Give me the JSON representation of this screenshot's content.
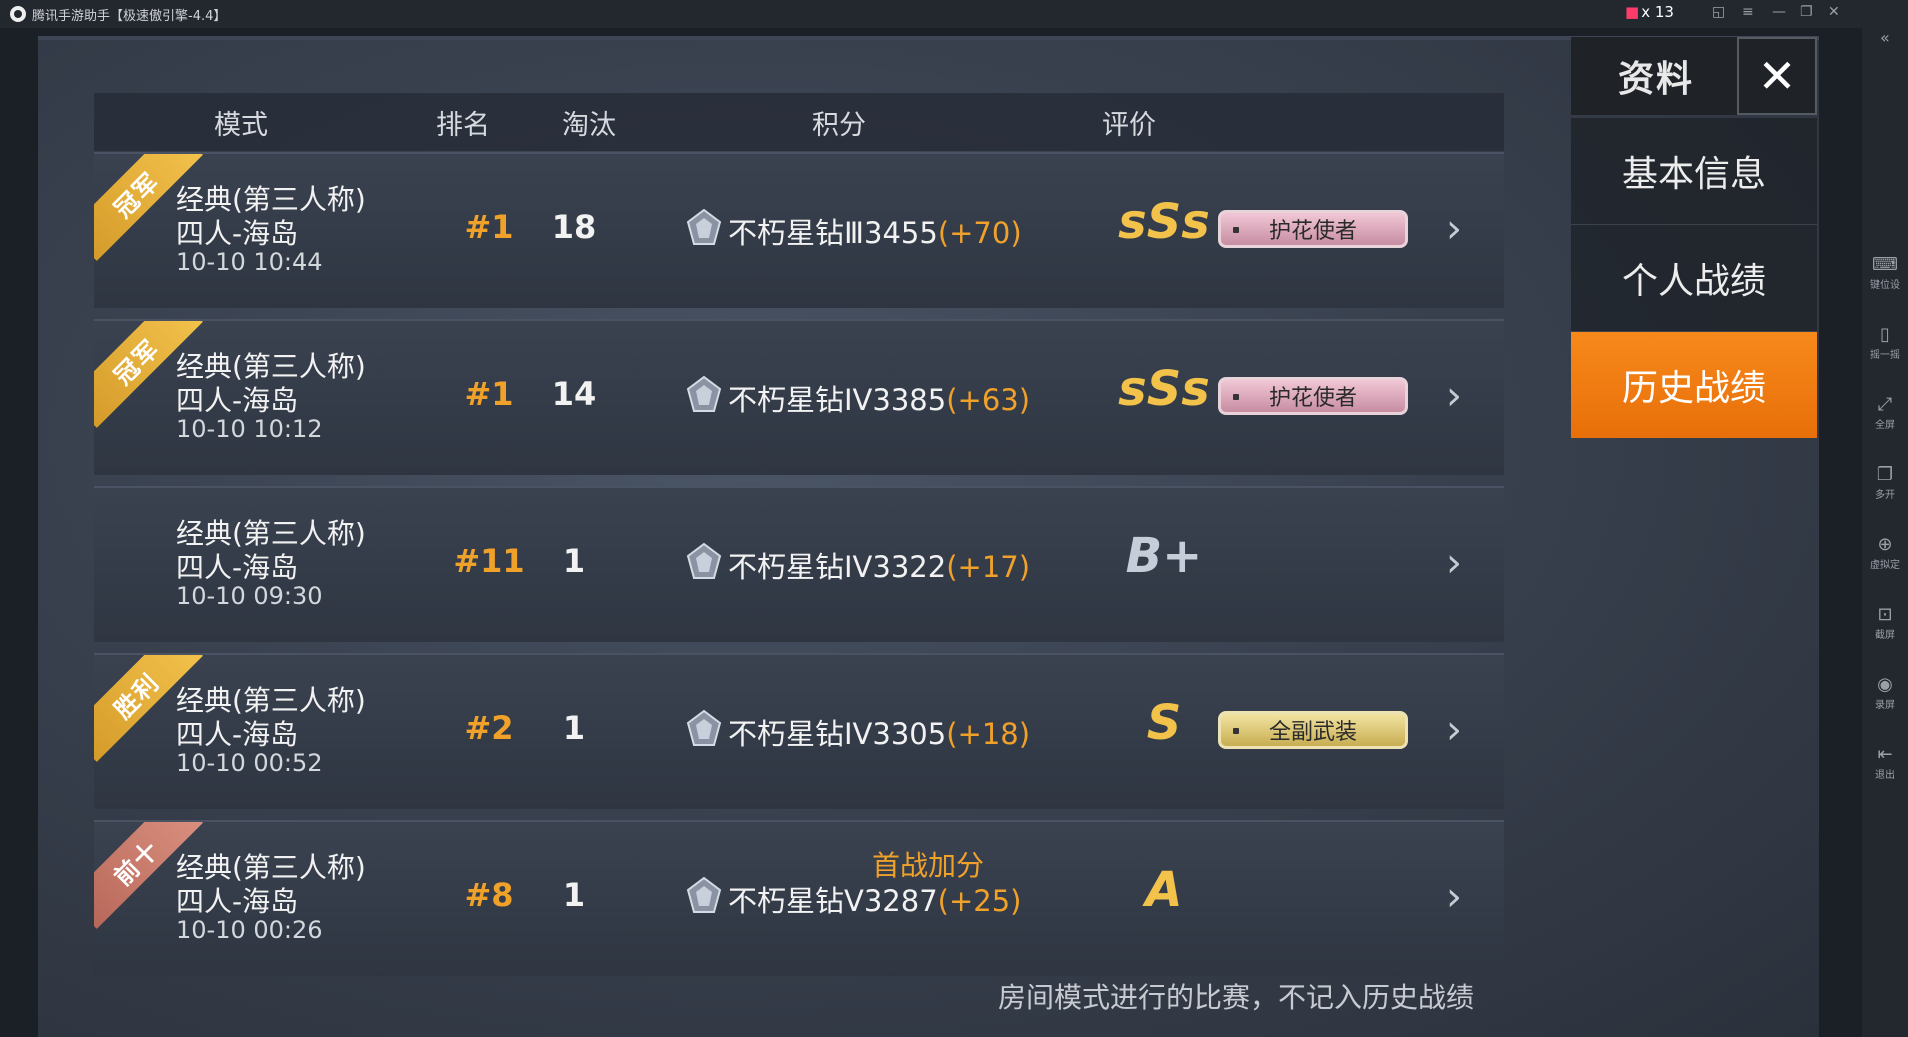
{
  "window": {
    "title": "腾讯手游助手【极速傲引擎-4.4】",
    "gift_count": "x 13"
  },
  "emulator_sidebar": [
    {
      "icon": "keyboard-icon",
      "label": "键位设"
    },
    {
      "icon": "shake-icon",
      "label": "摇一摇"
    },
    {
      "icon": "fullscreen-icon",
      "label": "全屏"
    },
    {
      "icon": "multi-window-icon",
      "label": "多开"
    },
    {
      "icon": "location-icon",
      "label": "虚拟定"
    },
    {
      "icon": "screenshot-icon",
      "label": "截屏"
    },
    {
      "icon": "record-icon",
      "label": "录屏"
    },
    {
      "icon": "exit-icon",
      "label": "退出"
    }
  ],
  "table": {
    "headers": {
      "mode": "模式",
      "rank": "排名",
      "kills": "淘汰",
      "score": "积分",
      "rating": "评价"
    },
    "rows": [
      {
        "ribbon": "冠军",
        "ribbon_color": "#e0a83a",
        "mode": "经典(第三人称)",
        "map": "四人-海岛",
        "datetime": "10-10 10:44",
        "rank": "#1",
        "kills": "18",
        "tier": "不朽星钻Ⅲ",
        "points": "3455",
        "delta": "(+70)",
        "bonus": "",
        "grade": "sSs",
        "tag": "护花使者",
        "tag_color": "pink"
      },
      {
        "ribbon": "冠军",
        "ribbon_color": "#e0a83a",
        "mode": "经典(第三人称)",
        "map": "四人-海岛",
        "datetime": "10-10 10:12",
        "rank": "#1",
        "kills": "14",
        "tier": "不朽星钻IV",
        "points": "3385",
        "delta": "(+63)",
        "bonus": "",
        "grade": "sSs",
        "tag": "护花使者",
        "tag_color": "pink"
      },
      {
        "ribbon": "",
        "ribbon_color": "",
        "mode": "经典(第三人称)",
        "map": "四人-海岛",
        "datetime": "10-10 09:30",
        "rank": "#11",
        "kills": "1",
        "tier": "不朽星钻IV",
        "points": "3322",
        "delta": "(+17)",
        "bonus": "",
        "grade": "B+",
        "tag": "",
        "tag_color": ""
      },
      {
        "ribbon": "胜利",
        "ribbon_color": "#e0a83a",
        "mode": "经典(第三人称)",
        "map": "四人-海岛",
        "datetime": "10-10 00:52",
        "rank": "#2",
        "kills": "1",
        "tier": "不朽星钻IV",
        "points": "3305",
        "delta": "(+18)",
        "bonus": "",
        "grade": "S",
        "tag": "全副武装",
        "tag_color": "gold"
      },
      {
        "ribbon": "前十",
        "ribbon_color": "#c97d6c",
        "mode": "经典(第三人称)",
        "map": "四人-海岛",
        "datetime": "10-10 00:26",
        "rank": "#8",
        "kills": "1",
        "tier": "不朽星钻Ⅴ",
        "points": "3287",
        "delta": "(+25)",
        "bonus": "首战加分",
        "grade": "A",
        "tag": "",
        "tag_color": ""
      }
    ]
  },
  "footer_note": "房间模式进行的比赛，不记入历史战绩",
  "right_panel": {
    "title": "资料",
    "close_icon": "close-icon",
    "menu": [
      {
        "label": "基本信息",
        "active": false
      },
      {
        "label": "个人战绩",
        "active": false
      },
      {
        "label": "历史战绩",
        "active": true
      }
    ]
  }
}
